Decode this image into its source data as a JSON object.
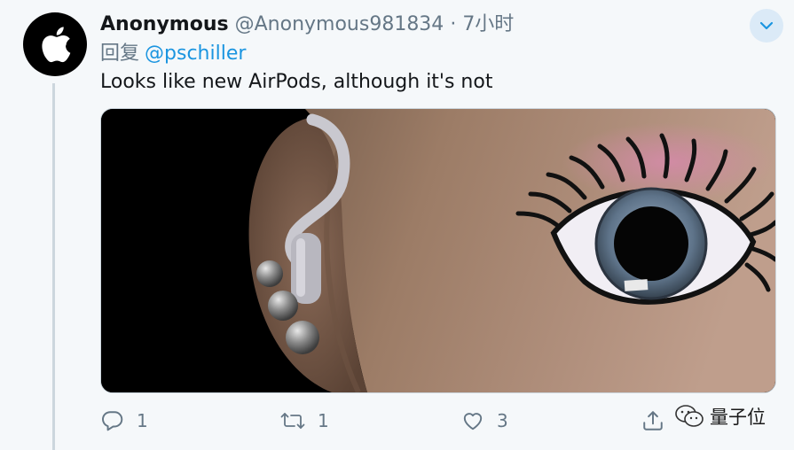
{
  "tweet": {
    "display_name": "Anonymous",
    "handle": "@Anonymous981834",
    "separator": "·",
    "time": "7小时",
    "reply_prefix": "回复",
    "reply_to": "@pschiller",
    "text": "Looks like new AirPods, although it's not"
  },
  "actions": {
    "reply_count": "1",
    "retweet_count": "1",
    "like_count": "3"
  },
  "watermark": {
    "text": "量子位"
  },
  "colors": {
    "link": "#1b95e0",
    "muted": "#657786",
    "background": "#f5f8fa",
    "chevron_bg": "#dbeaf7"
  },
  "icons": {
    "avatar_logo": "apple-logo",
    "menu": "chevron-down-icon",
    "reply": "comment-icon",
    "retweet": "retweet-icon",
    "like": "heart-icon",
    "share": "share-icon",
    "watermark": "wechat-icon"
  }
}
